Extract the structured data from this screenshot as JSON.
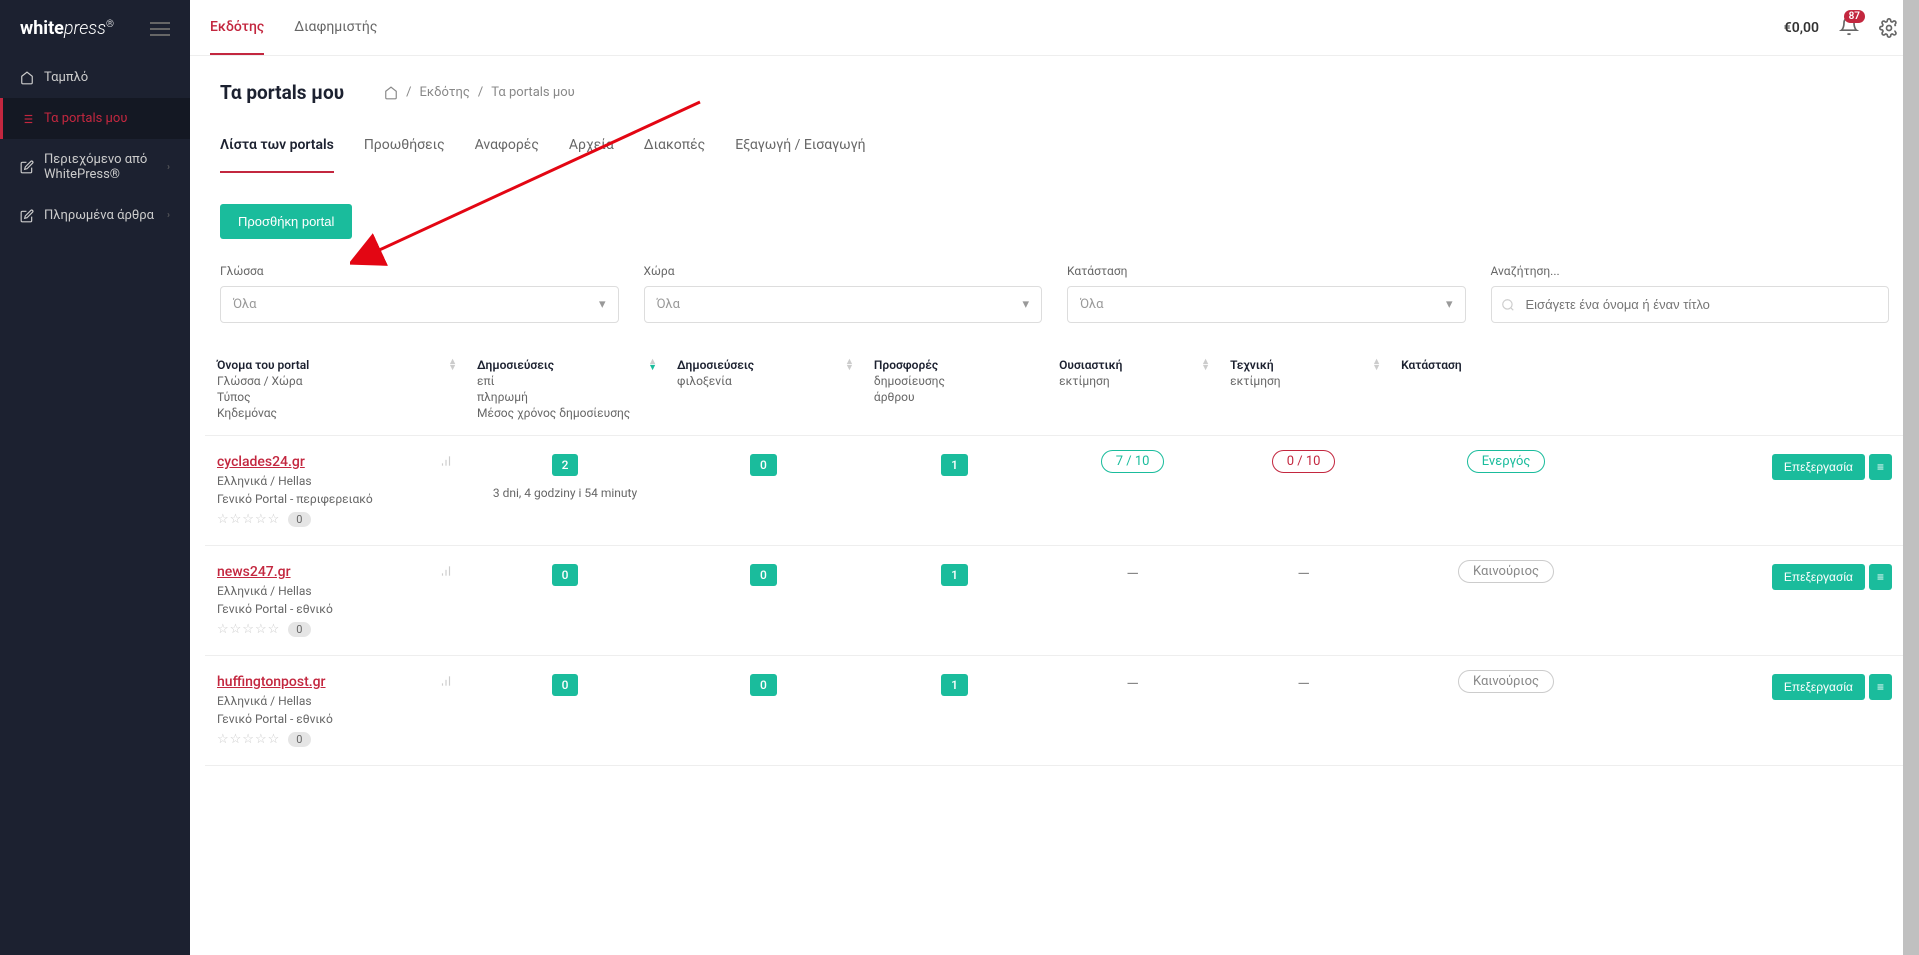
{
  "logo": {
    "white": "white",
    "press": "press",
    "reg": "®"
  },
  "nav": [
    {
      "label": "Ταμπλό",
      "icon": "home"
    },
    {
      "label": "Τα portals μου",
      "icon": "list",
      "active": true
    },
    {
      "label": "Περιεχόμενο από WhitePress®",
      "icon": "edit",
      "hasSub": true
    },
    {
      "label": "Πληρωμένα άρθρα",
      "icon": "edit",
      "hasSub": true
    }
  ],
  "topTabs": [
    {
      "label": "Εκδότης",
      "active": true
    },
    {
      "label": "Διαφημιστής"
    }
  ],
  "balance": "€0,00",
  "notificationCount": "87",
  "pageTitle": "Τα portals μου",
  "breadcrumb": {
    "sep": "/",
    "publisher": "Εκδότης",
    "current": "Τα portals μου"
  },
  "innerTabs": [
    {
      "label": "Λίστα των portals",
      "active": true
    },
    {
      "label": "Προωθήσεις"
    },
    {
      "label": "Αναφορές"
    },
    {
      "label": "Αρχεία"
    },
    {
      "label": "Διακοπές"
    },
    {
      "label": "Εξαγωγή / Εισαγωγή"
    }
  ],
  "addPortalBtn": "Προσθήκη portal",
  "filters": {
    "language": {
      "label": "Γλώσσα",
      "value": "Όλα"
    },
    "country": {
      "label": "Χώρα",
      "value": "Όλα"
    },
    "status": {
      "label": "Κατάσταση",
      "value": "Όλα"
    },
    "search": {
      "label": "Αναζήτηση...",
      "placeholder": "Εισάγετε ένα όνομα ή έναν τίτλο"
    }
  },
  "tableHeaders": {
    "name": {
      "main": "Όνομα του portal",
      "sub1": "Γλώσσα / Χώρα",
      "sub2": "Τύπος",
      "sub3": "Κηδεμόνας"
    },
    "pubPay": {
      "main": "Δημοσιεύσεις",
      "sub1": "επί",
      "sub2": "πληρωμή",
      "sub3": "Μέσος χρόνος δημοσίευσης"
    },
    "pubHost": {
      "main": "Δημοσιεύσεις",
      "sub1": "φιλοξενία"
    },
    "offers": {
      "main": "Προσφορές",
      "sub1": "δημοσίευσης",
      "sub2": "άρθρου"
    },
    "essential": {
      "main": "Ουσιαστική",
      "sub1": "εκτίμηση"
    },
    "technical": {
      "main": "Τεχνική",
      "sub1": "εκτίμηση"
    },
    "status": {
      "main": "Κατάσταση"
    }
  },
  "rows": [
    {
      "name": "cyclades24.gr",
      "lang": "Ελληνικά / Hellas",
      "type": "Γενικό Portal - περιφερειακό",
      "starCount": "0",
      "pubPay": "2",
      "avgTime": "3 dni, 4 godziny i 54 minuty",
      "pubHost": "0",
      "offers": "1",
      "essential": "7 / 10",
      "technical": "0 / 10",
      "status": "Ενεργός",
      "statusClass": "pill-outline-green",
      "techClass": "pill-outline-red",
      "editLabel": "Επεξεργασία"
    },
    {
      "name": "news247.gr",
      "lang": "Ελληνικά / Hellas",
      "type": "Γενικό Portal - εθνικό",
      "starCount": "0",
      "pubPay": "0",
      "avgTime": "",
      "pubHost": "0",
      "offers": "1",
      "essential": "—",
      "technical": "—",
      "status": "Καινούριος",
      "statusClass": "pill-outline-gray",
      "techClass": "",
      "editLabel": "Επεξεργασία"
    },
    {
      "name": "huffingtonpost.gr",
      "lang": "Ελληνικά / Hellas",
      "type": "Γενικό Portal - εθνικό",
      "starCount": "0",
      "pubPay": "0",
      "avgTime": "",
      "pubHost": "0",
      "offers": "1",
      "essential": "—",
      "technical": "—",
      "status": "Καινούριος",
      "statusClass": "pill-outline-gray",
      "techClass": "",
      "editLabel": "Επεξεργασία"
    }
  ]
}
